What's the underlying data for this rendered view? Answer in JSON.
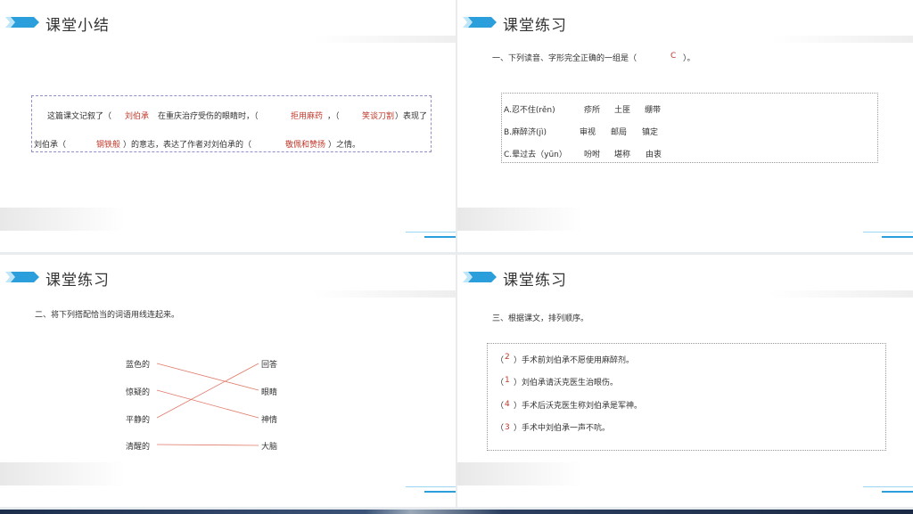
{
  "slide1": {
    "title": "课堂小结",
    "line1_a": "这篇课文记叙了（",
    "ans1": "刘伯承",
    "line1_b": "在重庆治疗受伤的眼睛时，（",
    "ans2": "拒用麻药",
    "line1_c": "，（",
    "ans3": "笑谈刀割",
    "line1_d": "）表现了",
    "line2_a": "刘伯承（",
    "ans4": "钢铁般",
    "line2_b": "）的意志，表达了作者对刘伯承的（",
    "ans5": "敬佩和赞扬",
    "line2_c": "）之情。"
  },
  "slide2": {
    "title": "课堂练习",
    "question": "一、下列读音、字形完全正确的一组是（",
    "answer": "C",
    "question_end": "）。",
    "options": [
      {
        "label": "A.忍不住(rěn)",
        "w1": "疹所",
        "w2": "土匪",
        "w3": "绷带"
      },
      {
        "label": "B.麻醉济(jì)",
        "w1": "审视",
        "w2": "邮局",
        "w3": "镇定"
      },
      {
        "label": "C.晕过去（yūn）",
        "w1": "吩咐",
        "w2": "堪称",
        "w3": "由衷"
      }
    ]
  },
  "slide3": {
    "title": "课堂练习",
    "question": "二、将下列搭配恰当的词语用线连起来。",
    "left": [
      "蓝色的",
      "惊疑的",
      "平静的",
      "清醒的"
    ],
    "right": [
      "回答",
      "眼睛",
      "神情",
      "大脑"
    ],
    "line_color": "#e07a6a"
  },
  "slide4": {
    "title": "课堂练习",
    "question": "三、根据课文，排列顺序。",
    "items": [
      {
        "num": "2",
        "text": "）手术前刘伯承不愿使用麻醉剂。"
      },
      {
        "num": "1",
        "text": "）刘伯承请沃克医生治眼伤。"
      },
      {
        "num": "4",
        "text": "）手术后沃克医生称刘伯承是军神。"
      },
      {
        "num": "3",
        "text": "）手术中刘伯承一声不吭。"
      }
    ]
  },
  "colors": {
    "accent": "#2b9fdb",
    "answer": "#c0392b"
  },
  "icons": {
    "logo": "blue-chevron-logo-icon"
  }
}
